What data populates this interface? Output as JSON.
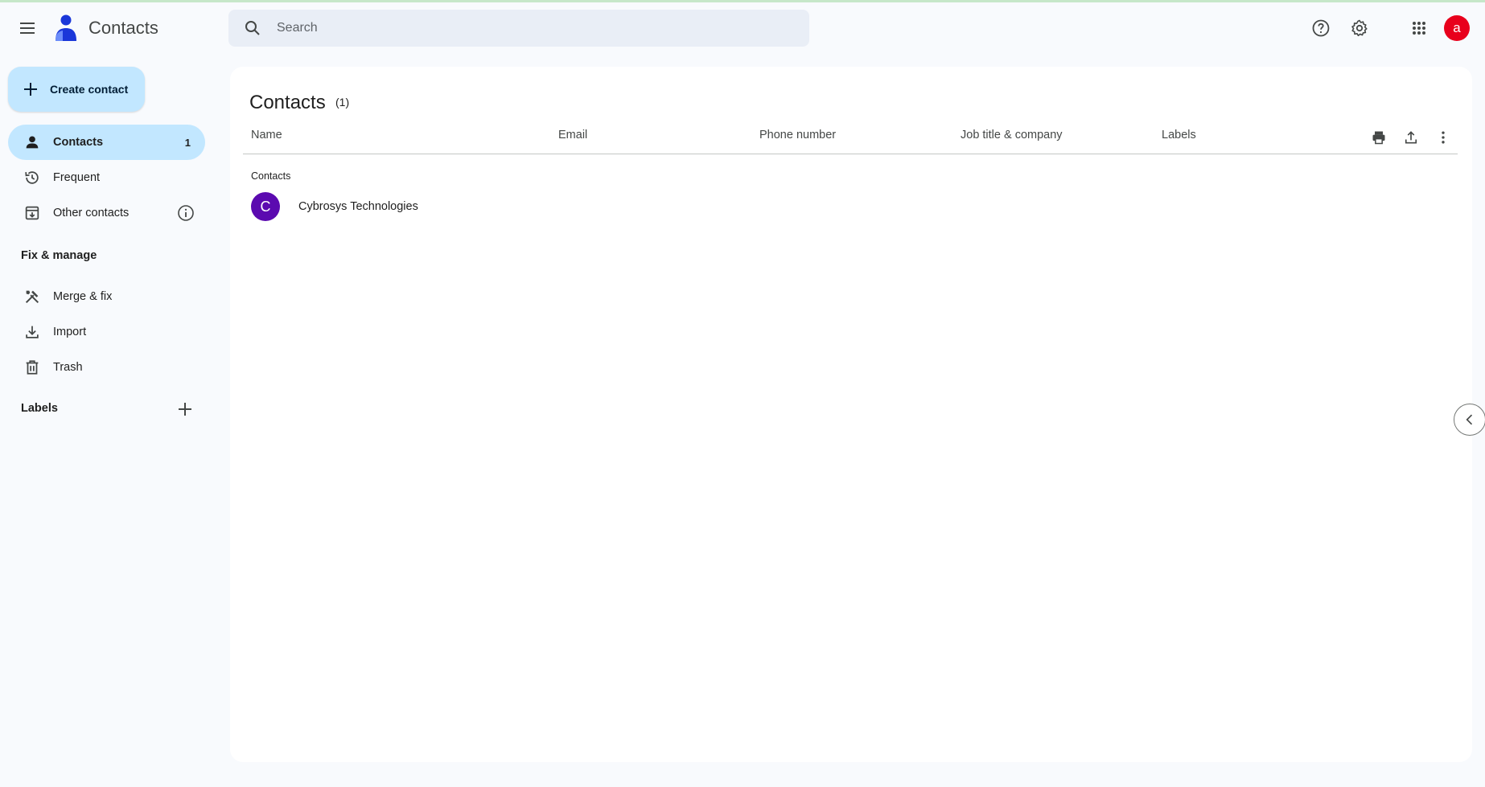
{
  "header": {
    "app_title": "Contacts",
    "search_placeholder": "Search",
    "avatar_letter": "a",
    "avatar_color": "#e8001c",
    "icons": [
      "menu-icon",
      "contacts-logo-icon",
      "search-icon",
      "help-icon",
      "settings-icon",
      "apps-icon"
    ]
  },
  "sidebar": {
    "create_label": "Create contact",
    "items": [
      {
        "label": "Contacts",
        "count": "1",
        "icon": "person-icon",
        "active": true
      },
      {
        "label": "Frequent",
        "icon": "history-icon"
      },
      {
        "label": "Other contacts",
        "icon": "inbox-download-icon"
      }
    ],
    "fix_manage_heading": "Fix & manage",
    "fix_items": [
      {
        "label": "Merge & fix",
        "icon": "tools-icon"
      },
      {
        "label": "Import",
        "icon": "download-icon"
      },
      {
        "label": "Trash",
        "icon": "trash-icon"
      }
    ],
    "labels_heading": "Labels"
  },
  "main": {
    "title": "Contacts",
    "count": "(1)",
    "columns": [
      "Name",
      "Email",
      "Phone number",
      "Job title & company",
      "Labels"
    ],
    "group_label": "Contacts",
    "contacts": [
      {
        "initial": "C",
        "name": "Cybrosys Technologies",
        "color": "#5b0ab0"
      }
    ]
  },
  "colors": {
    "accent": "#c2e7ff",
    "background": "#f8fafd"
  }
}
